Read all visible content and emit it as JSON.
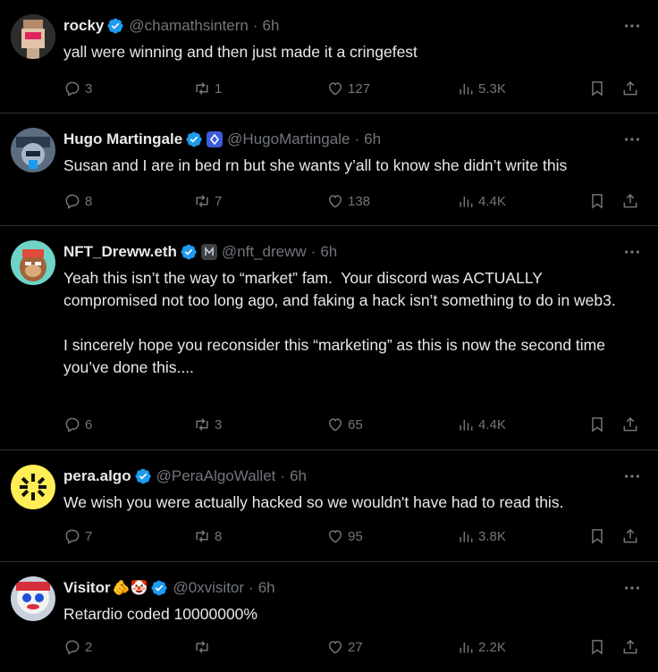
{
  "tweets": [
    {
      "name": "rocky",
      "handle": "@chamathsintern",
      "time": "6h",
      "text": "yall were winning and then just made it a cringefest",
      "replies": "3",
      "reposts": "1",
      "likes": "127",
      "views": "5.3K"
    },
    {
      "name": "Hugo Martingale",
      "handle": "@HugoMartingale",
      "time": "6h",
      "text": "Susan and I are in bed rn but she wants y’all to know she didn’t write this",
      "replies": "8",
      "reposts": "7",
      "likes": "138",
      "views": "4.4K"
    },
    {
      "name": "NFT_Dreww.eth",
      "handle": "@nft_dreww",
      "time": "6h",
      "text": "Yeah this isn’t the way to “market” fam.  Your discord was ACTUALLY compromised not too long ago, and faking a hack isn’t something to do in web3.\n\nI sincerely hope you reconsider this “marketing” as this is now the second time you’ve done this....",
      "replies": "6",
      "reposts": "3",
      "likes": "65",
      "views": "4.4K"
    },
    {
      "name": "pera.algo",
      "handle": "@PeraAlgoWallet",
      "time": "6h",
      "text": "We wish you were actually hacked so we wouldn't have had to read this.",
      "replies": "7",
      "reposts": "8",
      "likes": "95",
      "views": "3.8K"
    },
    {
      "name": "Visitor",
      "name_emoji": "🫵🤡",
      "handle": "@0xvisitor",
      "time": "6h",
      "text": "Retardio coded 10000000%",
      "replies": "2",
      "reposts": "",
      "likes": "27",
      "views": "2.2K"
    }
  ],
  "colors": {
    "background": "#000000",
    "text": "#e7e9ea",
    "muted": "#71767b",
    "verified": "#1d9bf0",
    "divider": "#2f3336"
  }
}
